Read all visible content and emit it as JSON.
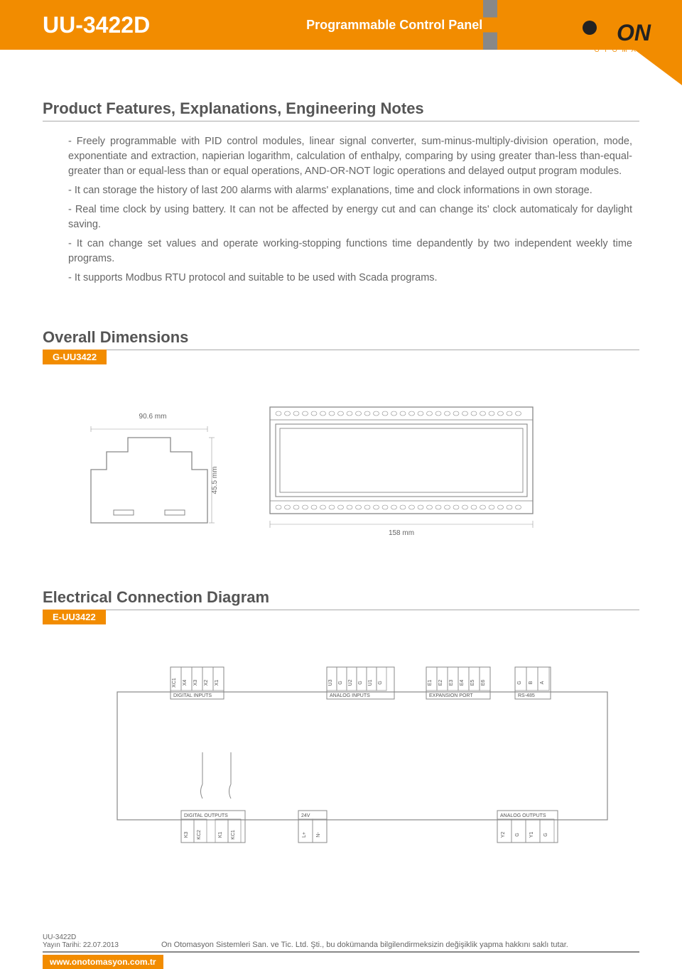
{
  "header": {
    "code": "UU-3422D",
    "subtitle": "Programmable Control Panel",
    "brand_top": "ON",
    "brand_sub": "O T O M A S Y O N"
  },
  "features": {
    "title": "Product Features, Explanations, Engineering Notes",
    "items": [
      "- Freely programmable with PID control modules, linear signal converter, sum-minus-multiply-division operation, mode, exponentiate and extraction, napierian logarithm, calculation of enthalpy, comparing by using greater than-less than-equal-greater than or equal-less than or equal operations, AND-OR-NOT logic operations and delayed output program modules.",
      "- It can storage the history of last 200 alarms with alarms' explanations, time and clock informations in own storage.",
      "- Real time clock by using battery. It can not be affected by energy cut and can change its' clock automaticaly for daylight saving.",
      "- It can change set values and operate working-stopping functions time depandently by two independent weekly time programs.",
      "- It supports Modbus RTU protocol and suitable to be used with Scada programs."
    ]
  },
  "dimensions": {
    "title": "Overall Dimensions",
    "tag": "G-UU3422",
    "width": "90.6 mm",
    "height": "45.5 mm",
    "length": "158 mm"
  },
  "electrical": {
    "title": "Electrical Connection Diagram",
    "tag": "E-UU3422",
    "digital_inputs": {
      "label": "DIGITAL INPUTS",
      "pins": [
        "XC1",
        "X4",
        "X3",
        "X2",
        "X1"
      ]
    },
    "analog_inputs": {
      "label": "ANALOG INPUTS",
      "pins": [
        "U3",
        "G",
        "U2",
        "G",
        "U1",
        "G"
      ]
    },
    "expansion": {
      "label": "EXPANSION PORT",
      "pins": [
        "E1",
        "E2",
        "E3",
        "E4",
        "E5",
        "E6"
      ]
    },
    "rs485": {
      "label": "RS-485",
      "pins": [
        "G",
        "B",
        "A"
      ]
    },
    "digital_outputs": {
      "label": "DIGITAL OUTPUTS",
      "pins": [
        "K3",
        "KC2",
        "K1",
        "KC1"
      ]
    },
    "v24": {
      "label": "24V",
      "pins": [
        "L+",
        "N-"
      ]
    },
    "analog_outputs": {
      "label": "ANALOG OUTPUTS",
      "pins": [
        "Y2",
        "G",
        "Y1",
        "G"
      ]
    }
  },
  "footer": {
    "code": "UU-3422D",
    "date": "Yayın Tarihi: 22.07.2013",
    "legal": "On Otomasyon Sistemleri San. ve Tic. Ltd. Şti., bu dokümanda bilgilendirmeksizin değişiklik yapma hakkını saklı tutar.",
    "url": "www.onotomasyon.com.tr"
  }
}
